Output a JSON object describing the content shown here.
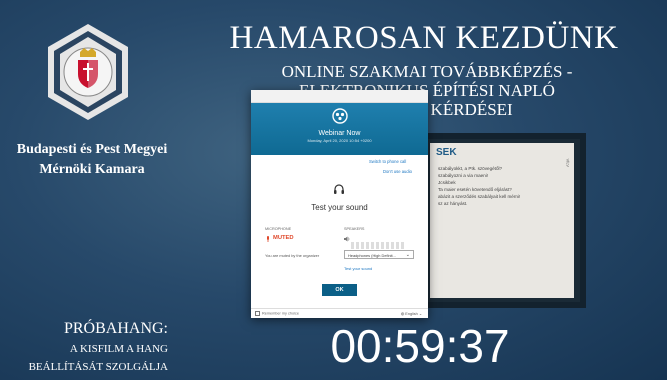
{
  "header": {
    "title": "HAMAROSAN KEZDÜNK",
    "subtitle_1": "ONLINE SZAKMAI TOVÁBBKÉPZÉS -",
    "subtitle_2": "ELEKTRONIKUS ÉPÍTÉSI NAPLÓ",
    "subtitle_3": "AKTUÁLIS KÉRDÉSEI"
  },
  "organization": {
    "line_1": "Budapesti és Pest Megyei",
    "line_2": "Mérnöki Kamara"
  },
  "slide_preview": {
    "heading": "SEK",
    "lines": [
      "szabályokkt, a Ptk. szövegétől?",
      "szabályozni a via maeni!",
      "Jcsikbek",
      "Ta maier esetén követendő eljárást?",
      "abázit a szerződés szabályait kell mérni!",
      "sz az hányást."
    ],
    "side_text": "VÍLV"
  },
  "dialog": {
    "app_title": "Webinar Now",
    "date": "Monday, April 20, 2020   10:54 +0200",
    "switch_to_phone": "Switch to phone call",
    "dont_use_audio": "Don't use audio",
    "test_title": "Test your sound",
    "microphone_label": "MICROPHONE",
    "speakers_label": "SPEAKERS",
    "muted": "MUTED",
    "muted_note": "You are muted by the organizer",
    "speaker_device": "Headphones (High Definit...",
    "test_sound_link": "Test your sound",
    "ok_label": "OK",
    "remember": "Remember my choice",
    "language": "English"
  },
  "bottom": {
    "probe_1": "PRÓBAHANG:",
    "probe_2": "A KISFILM A HANG",
    "probe_3": "BEÁLLÍTÁSÁT SZOLGÁLJA",
    "timer": "00:59:37"
  },
  "colors": {
    "background": "#27496a",
    "accent": "#1f7fae",
    "muted": "#e0492c"
  }
}
